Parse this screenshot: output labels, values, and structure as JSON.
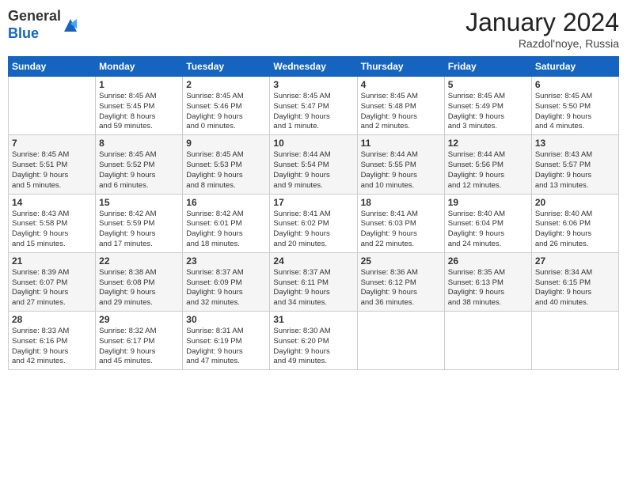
{
  "logo": {
    "general": "General",
    "blue": "Blue"
  },
  "header": {
    "month": "January 2024",
    "location": "Razdol'noye, Russia"
  },
  "days_of_week": [
    "Sunday",
    "Monday",
    "Tuesday",
    "Wednesday",
    "Thursday",
    "Friday",
    "Saturday"
  ],
  "weeks": [
    [
      {
        "day": "",
        "info": ""
      },
      {
        "day": "1",
        "info": "Sunrise: 8:45 AM\nSunset: 5:45 PM\nDaylight: 8 hours\nand 59 minutes."
      },
      {
        "day": "2",
        "info": "Sunrise: 8:45 AM\nSunset: 5:46 PM\nDaylight: 9 hours\nand 0 minutes."
      },
      {
        "day": "3",
        "info": "Sunrise: 8:45 AM\nSunset: 5:47 PM\nDaylight: 9 hours\nand 1 minute."
      },
      {
        "day": "4",
        "info": "Sunrise: 8:45 AM\nSunset: 5:48 PM\nDaylight: 9 hours\nand 2 minutes."
      },
      {
        "day": "5",
        "info": "Sunrise: 8:45 AM\nSunset: 5:49 PM\nDaylight: 9 hours\nand 3 minutes."
      },
      {
        "day": "6",
        "info": "Sunrise: 8:45 AM\nSunset: 5:50 PM\nDaylight: 9 hours\nand 4 minutes."
      }
    ],
    [
      {
        "day": "7",
        "info": "Sunrise: 8:45 AM\nSunset: 5:51 PM\nDaylight: 9 hours\nand 5 minutes."
      },
      {
        "day": "8",
        "info": "Sunrise: 8:45 AM\nSunset: 5:52 PM\nDaylight: 9 hours\nand 6 minutes."
      },
      {
        "day": "9",
        "info": "Sunrise: 8:45 AM\nSunset: 5:53 PM\nDaylight: 9 hours\nand 8 minutes."
      },
      {
        "day": "10",
        "info": "Sunrise: 8:44 AM\nSunset: 5:54 PM\nDaylight: 9 hours\nand 9 minutes."
      },
      {
        "day": "11",
        "info": "Sunrise: 8:44 AM\nSunset: 5:55 PM\nDaylight: 9 hours\nand 10 minutes."
      },
      {
        "day": "12",
        "info": "Sunrise: 8:44 AM\nSunset: 5:56 PM\nDaylight: 9 hours\nand 12 minutes."
      },
      {
        "day": "13",
        "info": "Sunrise: 8:43 AM\nSunset: 5:57 PM\nDaylight: 9 hours\nand 13 minutes."
      }
    ],
    [
      {
        "day": "14",
        "info": "Sunrise: 8:43 AM\nSunset: 5:58 PM\nDaylight: 9 hours\nand 15 minutes."
      },
      {
        "day": "15",
        "info": "Sunrise: 8:42 AM\nSunset: 5:59 PM\nDaylight: 9 hours\nand 17 minutes."
      },
      {
        "day": "16",
        "info": "Sunrise: 8:42 AM\nSunset: 6:01 PM\nDaylight: 9 hours\nand 18 minutes."
      },
      {
        "day": "17",
        "info": "Sunrise: 8:41 AM\nSunset: 6:02 PM\nDaylight: 9 hours\nand 20 minutes."
      },
      {
        "day": "18",
        "info": "Sunrise: 8:41 AM\nSunset: 6:03 PM\nDaylight: 9 hours\nand 22 minutes."
      },
      {
        "day": "19",
        "info": "Sunrise: 8:40 AM\nSunset: 6:04 PM\nDaylight: 9 hours\nand 24 minutes."
      },
      {
        "day": "20",
        "info": "Sunrise: 8:40 AM\nSunset: 6:06 PM\nDaylight: 9 hours\nand 26 minutes."
      }
    ],
    [
      {
        "day": "21",
        "info": "Sunrise: 8:39 AM\nSunset: 6:07 PM\nDaylight: 9 hours\nand 27 minutes."
      },
      {
        "day": "22",
        "info": "Sunrise: 8:38 AM\nSunset: 6:08 PM\nDaylight: 9 hours\nand 29 minutes."
      },
      {
        "day": "23",
        "info": "Sunrise: 8:37 AM\nSunset: 6:09 PM\nDaylight: 9 hours\nand 32 minutes."
      },
      {
        "day": "24",
        "info": "Sunrise: 8:37 AM\nSunset: 6:11 PM\nDaylight: 9 hours\nand 34 minutes."
      },
      {
        "day": "25",
        "info": "Sunrise: 8:36 AM\nSunset: 6:12 PM\nDaylight: 9 hours\nand 36 minutes."
      },
      {
        "day": "26",
        "info": "Sunrise: 8:35 AM\nSunset: 6:13 PM\nDaylight: 9 hours\nand 38 minutes."
      },
      {
        "day": "27",
        "info": "Sunrise: 8:34 AM\nSunset: 6:15 PM\nDaylight: 9 hours\nand 40 minutes."
      }
    ],
    [
      {
        "day": "28",
        "info": "Sunrise: 8:33 AM\nSunset: 6:16 PM\nDaylight: 9 hours\nand 42 minutes."
      },
      {
        "day": "29",
        "info": "Sunrise: 8:32 AM\nSunset: 6:17 PM\nDaylight: 9 hours\nand 45 minutes."
      },
      {
        "day": "30",
        "info": "Sunrise: 8:31 AM\nSunset: 6:19 PM\nDaylight: 9 hours\nand 47 minutes."
      },
      {
        "day": "31",
        "info": "Sunrise: 8:30 AM\nSunset: 6:20 PM\nDaylight: 9 hours\nand 49 minutes."
      },
      {
        "day": "",
        "info": ""
      },
      {
        "day": "",
        "info": ""
      },
      {
        "day": "",
        "info": ""
      }
    ]
  ]
}
